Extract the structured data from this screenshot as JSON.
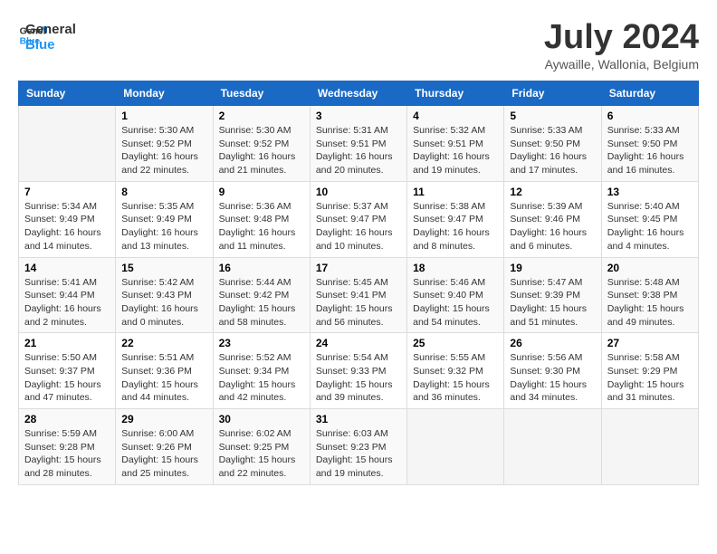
{
  "header": {
    "logo_line1": "General",
    "logo_line2": "Blue",
    "month": "July 2024",
    "location": "Aywaille, Wallonia, Belgium"
  },
  "weekdays": [
    "Sunday",
    "Monday",
    "Tuesday",
    "Wednesday",
    "Thursday",
    "Friday",
    "Saturday"
  ],
  "weeks": [
    [
      {
        "day": "",
        "info": ""
      },
      {
        "day": "1",
        "info": "Sunrise: 5:30 AM\nSunset: 9:52 PM\nDaylight: 16 hours\nand 22 minutes."
      },
      {
        "day": "2",
        "info": "Sunrise: 5:30 AM\nSunset: 9:52 PM\nDaylight: 16 hours\nand 21 minutes."
      },
      {
        "day": "3",
        "info": "Sunrise: 5:31 AM\nSunset: 9:51 PM\nDaylight: 16 hours\nand 20 minutes."
      },
      {
        "day": "4",
        "info": "Sunrise: 5:32 AM\nSunset: 9:51 PM\nDaylight: 16 hours\nand 19 minutes."
      },
      {
        "day": "5",
        "info": "Sunrise: 5:33 AM\nSunset: 9:50 PM\nDaylight: 16 hours\nand 17 minutes."
      },
      {
        "day": "6",
        "info": "Sunrise: 5:33 AM\nSunset: 9:50 PM\nDaylight: 16 hours\nand 16 minutes."
      }
    ],
    [
      {
        "day": "7",
        "info": "Sunrise: 5:34 AM\nSunset: 9:49 PM\nDaylight: 16 hours\nand 14 minutes."
      },
      {
        "day": "8",
        "info": "Sunrise: 5:35 AM\nSunset: 9:49 PM\nDaylight: 16 hours\nand 13 minutes."
      },
      {
        "day": "9",
        "info": "Sunrise: 5:36 AM\nSunset: 9:48 PM\nDaylight: 16 hours\nand 11 minutes."
      },
      {
        "day": "10",
        "info": "Sunrise: 5:37 AM\nSunset: 9:47 PM\nDaylight: 16 hours\nand 10 minutes."
      },
      {
        "day": "11",
        "info": "Sunrise: 5:38 AM\nSunset: 9:47 PM\nDaylight: 16 hours\nand 8 minutes."
      },
      {
        "day": "12",
        "info": "Sunrise: 5:39 AM\nSunset: 9:46 PM\nDaylight: 16 hours\nand 6 minutes."
      },
      {
        "day": "13",
        "info": "Sunrise: 5:40 AM\nSunset: 9:45 PM\nDaylight: 16 hours\nand 4 minutes."
      }
    ],
    [
      {
        "day": "14",
        "info": "Sunrise: 5:41 AM\nSunset: 9:44 PM\nDaylight: 16 hours\nand 2 minutes."
      },
      {
        "day": "15",
        "info": "Sunrise: 5:42 AM\nSunset: 9:43 PM\nDaylight: 16 hours\nand 0 minutes."
      },
      {
        "day": "16",
        "info": "Sunrise: 5:44 AM\nSunset: 9:42 PM\nDaylight: 15 hours\nand 58 minutes."
      },
      {
        "day": "17",
        "info": "Sunrise: 5:45 AM\nSunset: 9:41 PM\nDaylight: 15 hours\nand 56 minutes."
      },
      {
        "day": "18",
        "info": "Sunrise: 5:46 AM\nSunset: 9:40 PM\nDaylight: 15 hours\nand 54 minutes."
      },
      {
        "day": "19",
        "info": "Sunrise: 5:47 AM\nSunset: 9:39 PM\nDaylight: 15 hours\nand 51 minutes."
      },
      {
        "day": "20",
        "info": "Sunrise: 5:48 AM\nSunset: 9:38 PM\nDaylight: 15 hours\nand 49 minutes."
      }
    ],
    [
      {
        "day": "21",
        "info": "Sunrise: 5:50 AM\nSunset: 9:37 PM\nDaylight: 15 hours\nand 47 minutes."
      },
      {
        "day": "22",
        "info": "Sunrise: 5:51 AM\nSunset: 9:36 PM\nDaylight: 15 hours\nand 44 minutes."
      },
      {
        "day": "23",
        "info": "Sunrise: 5:52 AM\nSunset: 9:34 PM\nDaylight: 15 hours\nand 42 minutes."
      },
      {
        "day": "24",
        "info": "Sunrise: 5:54 AM\nSunset: 9:33 PM\nDaylight: 15 hours\nand 39 minutes."
      },
      {
        "day": "25",
        "info": "Sunrise: 5:55 AM\nSunset: 9:32 PM\nDaylight: 15 hours\nand 36 minutes."
      },
      {
        "day": "26",
        "info": "Sunrise: 5:56 AM\nSunset: 9:30 PM\nDaylight: 15 hours\nand 34 minutes."
      },
      {
        "day": "27",
        "info": "Sunrise: 5:58 AM\nSunset: 9:29 PM\nDaylight: 15 hours\nand 31 minutes."
      }
    ],
    [
      {
        "day": "28",
        "info": "Sunrise: 5:59 AM\nSunset: 9:28 PM\nDaylight: 15 hours\nand 28 minutes."
      },
      {
        "day": "29",
        "info": "Sunrise: 6:00 AM\nSunset: 9:26 PM\nDaylight: 15 hours\nand 25 minutes."
      },
      {
        "day": "30",
        "info": "Sunrise: 6:02 AM\nSunset: 9:25 PM\nDaylight: 15 hours\nand 22 minutes."
      },
      {
        "day": "31",
        "info": "Sunrise: 6:03 AM\nSunset: 9:23 PM\nDaylight: 15 hours\nand 19 minutes."
      },
      {
        "day": "",
        "info": ""
      },
      {
        "day": "",
        "info": ""
      },
      {
        "day": "",
        "info": ""
      }
    ]
  ]
}
